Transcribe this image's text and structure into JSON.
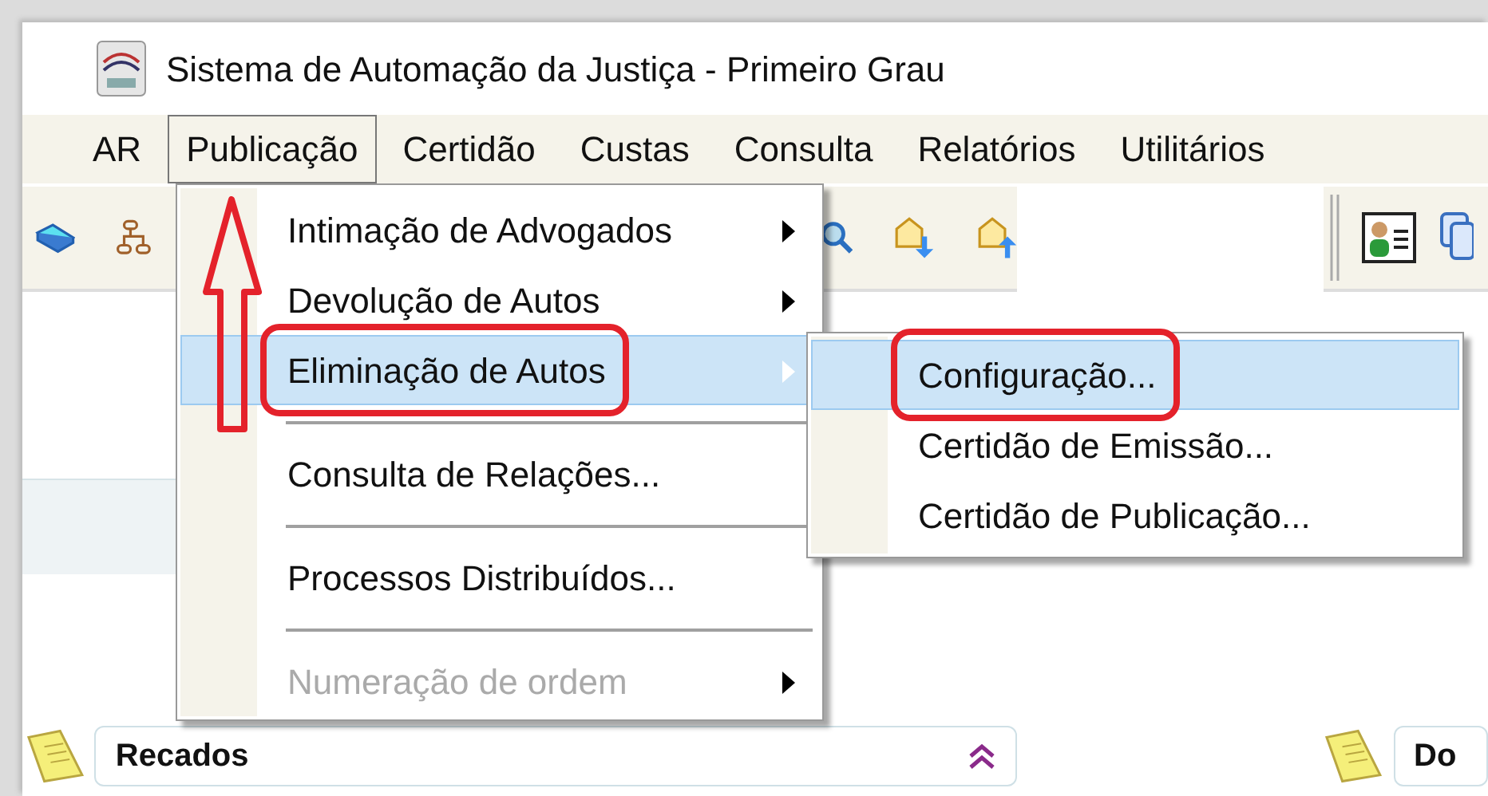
{
  "window": {
    "title": "Sistema de Automação da Justiça - Primeiro Grau"
  },
  "menu_bar": [
    {
      "label": "AR",
      "selected": false
    },
    {
      "label": "Publicação",
      "selected": true
    },
    {
      "label": "Certidão",
      "selected": false
    },
    {
      "label": "Custas",
      "selected": false
    },
    {
      "label": "Consulta",
      "selected": false
    },
    {
      "label": "Relatórios",
      "selected": false
    },
    {
      "label": "Utilitários",
      "selected": false
    }
  ],
  "menu": {
    "items": [
      {
        "kind": "item",
        "label": "Intimação de Advogados",
        "submenu": true,
        "highlighted": false,
        "disabled": false,
        "circled": false
      },
      {
        "kind": "item",
        "label": "Devolução de Autos",
        "submenu": true,
        "highlighted": false,
        "disabled": false,
        "circled": false
      },
      {
        "kind": "item",
        "label": "Eliminação de Autos",
        "submenu": true,
        "highlighted": true,
        "disabled": false,
        "circled": true
      },
      {
        "kind": "separator"
      },
      {
        "kind": "item",
        "label": "Consulta de Relações...",
        "submenu": false,
        "highlighted": false,
        "disabled": false,
        "circled": false
      },
      {
        "kind": "separator"
      },
      {
        "kind": "item",
        "label": "Processos Distribuídos...",
        "submenu": false,
        "highlighted": false,
        "disabled": false,
        "circled": false
      },
      {
        "kind": "separator"
      },
      {
        "kind": "item",
        "label": "Numeração de ordem",
        "submenu": true,
        "highlighted": false,
        "disabled": true,
        "circled": false
      }
    ]
  },
  "submenu": {
    "items": [
      {
        "kind": "item",
        "label": "Configuração...",
        "submenu": false,
        "highlighted": true,
        "disabled": false,
        "circled": true
      },
      {
        "kind": "item",
        "label": "Certidão de Emissão...",
        "submenu": false,
        "highlighted": false,
        "disabled": false,
        "circled": false
      },
      {
        "kind": "item",
        "label": "Certidão de Publicação...",
        "submenu": false,
        "highlighted": false,
        "disabled": false,
        "circled": false
      }
    ]
  },
  "panels": [
    {
      "title": "Recados",
      "collapse_button": true
    },
    {
      "title": "Do",
      "collapse_button": false
    }
  ]
}
